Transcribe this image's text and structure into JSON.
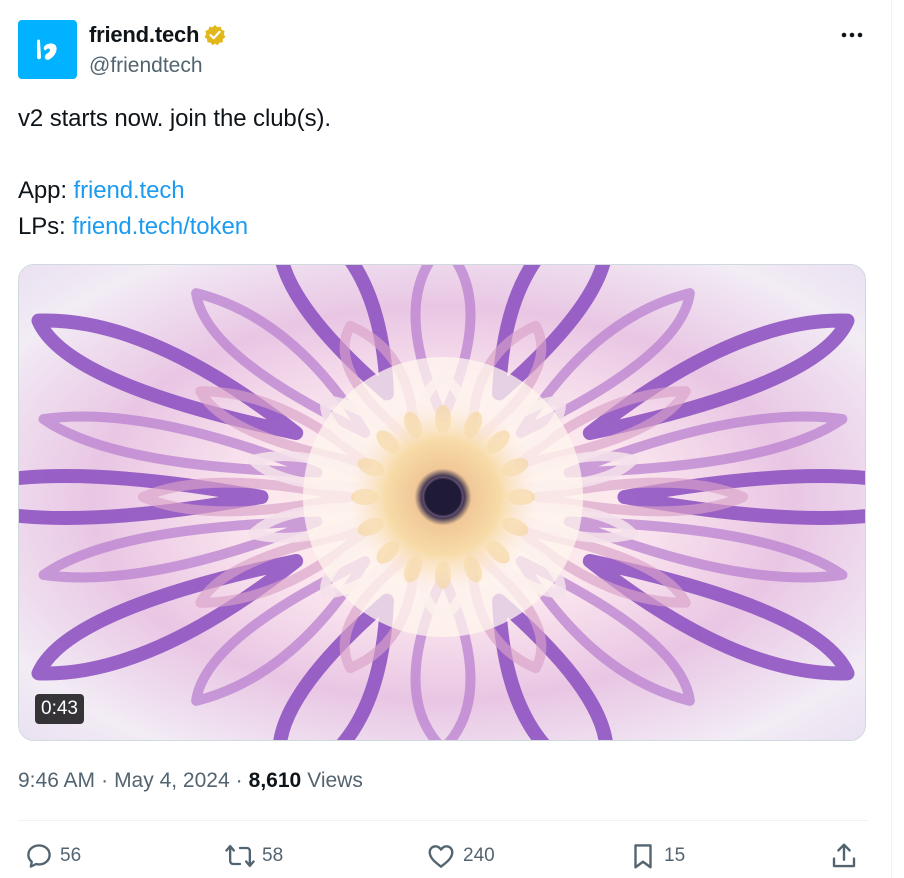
{
  "author": {
    "display_name": "friend.tech",
    "handle": "@friendtech",
    "avatar_color": "#00b2ff",
    "verified_color": "#e2b719",
    "icons": {
      "verified": "verified-badge-icon",
      "more": "more-options-icon"
    }
  },
  "tweet": {
    "line1": "v2 starts now. join the club(s).",
    "app_prefix": "App: ",
    "app_link": "friend.tech",
    "lps_prefix": "LPs: ",
    "lps_link": "friend.tech/token",
    "link_color": "#1d9bf0"
  },
  "media": {
    "type": "video",
    "duration": "0:43"
  },
  "meta": {
    "time": "9:46 AM",
    "separator": "·",
    "date": "May 4, 2024",
    "views_count": "8,610",
    "views_label": "Views"
  },
  "actions": {
    "replies": {
      "count": "56",
      "icon": "reply-icon"
    },
    "reposts": {
      "count": "58",
      "icon": "repost-icon"
    },
    "likes": {
      "count": "240",
      "icon": "like-icon"
    },
    "bookmarks": {
      "count": "15",
      "icon": "bookmark-icon"
    },
    "share": {
      "icon": "share-icon"
    }
  }
}
